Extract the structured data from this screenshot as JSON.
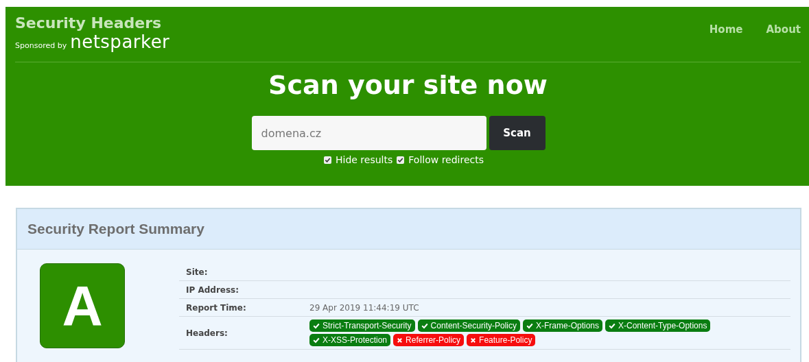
{
  "brand": {
    "title": "Security Headers",
    "sponsor_label": "Sponsored by",
    "sponsor_name": "netsparker"
  },
  "nav": [
    "Home",
    "About"
  ],
  "scan": {
    "heading": "Scan your site now",
    "value": "domena.cz",
    "button": "Scan",
    "options": [
      {
        "label": "Hide results",
        "checked": true
      },
      {
        "label": "Follow redirects",
        "checked": true
      }
    ]
  },
  "report": {
    "title": "Security Report Summary",
    "grade": "A",
    "rows": [
      {
        "label": "Site:"
      },
      {
        "label": "IP Address:"
      },
      {
        "label": "Report Time:",
        "value": "29 Apr 2019 11:44:19 UTC"
      }
    ],
    "headers_label": "Headers:",
    "headers": [
      {
        "name": "Strict-Transport-Security",
        "kind": "pass"
      },
      {
        "name": "Content-Security-Policy",
        "kind": "pass"
      },
      {
        "name": "X-Frame-Options",
        "kind": "pass"
      },
      {
        "name": "X-Content-Type-Options",
        "kind": "pass"
      },
      {
        "name": "X-XSS-Protection",
        "kind": "pass"
      },
      {
        "name": "Referrer-Policy",
        "kind": "fail"
      },
      {
        "name": "Feature-Policy",
        "kind": "fail"
      }
    ]
  }
}
